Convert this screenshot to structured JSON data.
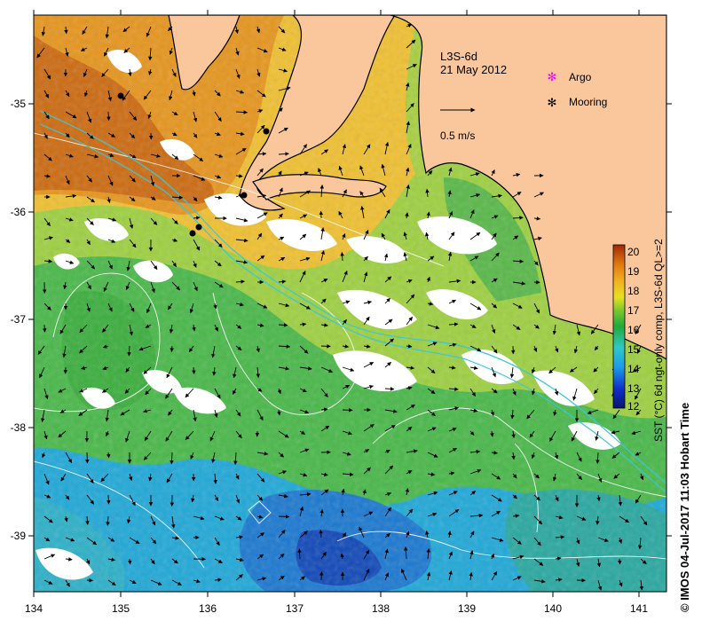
{
  "map": {
    "product_label": "L3S-6d",
    "date_label": "21 May 2012",
    "vector_scale_label": "0.5 m/s",
    "lon_ticks": [
      "134",
      "135",
      "136",
      "137",
      "138",
      "139",
      "140",
      "141"
    ],
    "lat_ticks": [
      "-35",
      "-36",
      "-37",
      "-38",
      "-39"
    ],
    "legend": {
      "argo_label": "Argo",
      "mooring_label": "Mooring"
    },
    "colorbar": {
      "label": "SST (°C) 6d ngt-only comp, L3S-6d QL>=2",
      "ticks": [
        "20",
        "19",
        "18",
        "17",
        "16",
        "15",
        "14",
        "13",
        "12"
      ]
    },
    "credit": "© IMOS 04-Jul-2017 11:03 Hobart Time",
    "colors": {
      "land": "#f9c79b",
      "warm": "#d98a1a",
      "mid": "#f0b52c",
      "cool": "#3cb34a",
      "cold": "#1e90d8",
      "no_data": "#ffffff"
    }
  }
}
